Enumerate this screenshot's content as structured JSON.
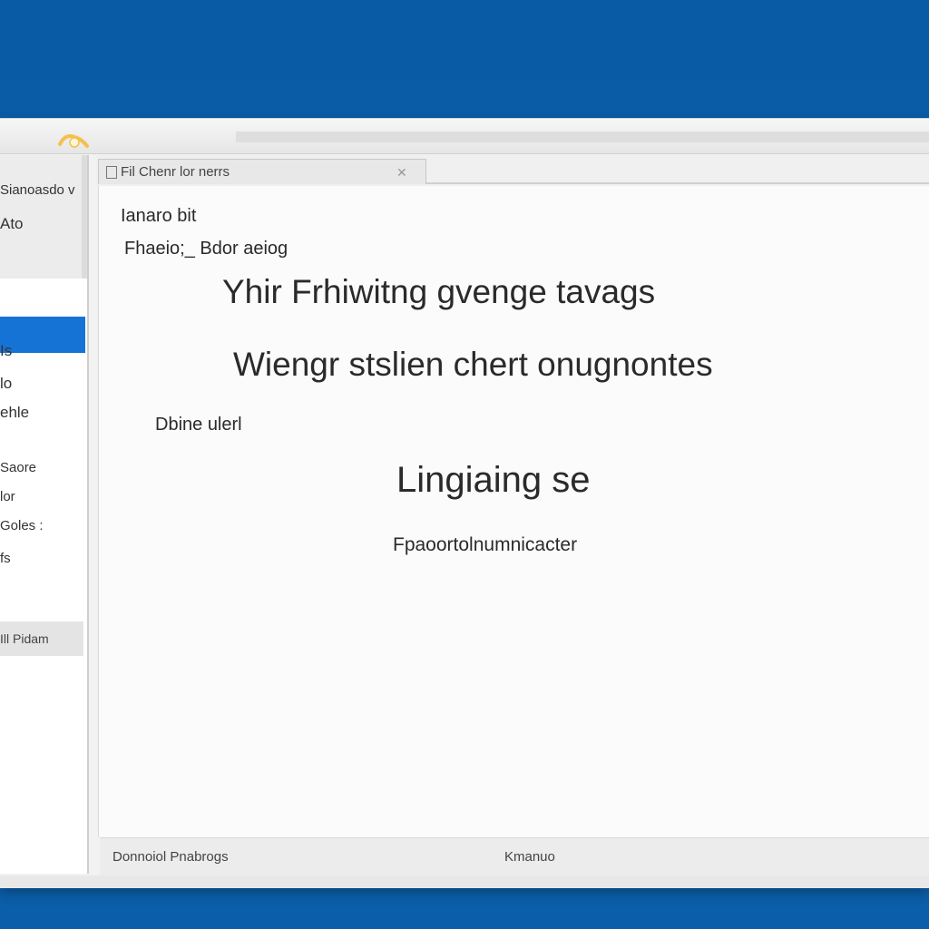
{
  "window": {
    "tab_title": "Fil Chenr lor nerrs"
  },
  "sidebar": {
    "items": [
      {
        "label": "Sianoasdo v"
      },
      {
        "label": "Ato"
      },
      {
        "label": "Is"
      },
      {
        "label": "lo"
      },
      {
        "label": "ehle"
      },
      {
        "label": "Saore"
      },
      {
        "label": "lor"
      },
      {
        "label": "Goles :"
      },
      {
        "label": "fs"
      }
    ],
    "footer_label": "Ill Pidam"
  },
  "content": {
    "line1": "Ianaro bit",
    "line2": "Fhaeio;_ Bdor aeiog",
    "heading1": "Yhir Frhiwitng gvenge tavags",
    "heading2": "Wiengr stslien chert onugnontes",
    "line3": "Dbine ulerl",
    "subtitle": "Lingiaing se",
    "caption": "Fpaoortolnumnicacter"
  },
  "statusbar": {
    "left_text": "Donnoiol Pnabrogs",
    "center_text": "Kmanuo"
  },
  "colors": {
    "desktop": "#0b5ea9",
    "selection": "#1673d6",
    "accent_icon": "#f2c14e"
  },
  "icons": {
    "app": "app-logo-icon",
    "tab_close": "close-icon",
    "tab_checkbox": "checkbox-icon"
  }
}
